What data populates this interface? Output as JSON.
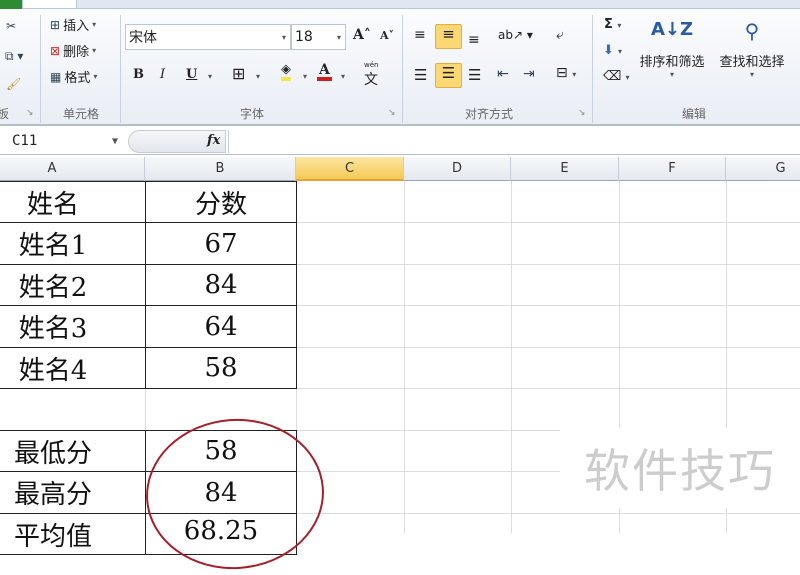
{
  "ribbon": {
    "cells_group": {
      "label": "单元格",
      "insert": "插入",
      "delete": "删除",
      "format": "格式"
    },
    "font_group": {
      "label": "字体",
      "font_name": "宋体",
      "font_size": "18",
      "bold": "B",
      "italic": "I",
      "underline": "U",
      "font_color_label": "A",
      "wen": "wén"
    },
    "alignment_group": {
      "label": "对齐方式"
    },
    "editing_group": {
      "label": "编辑",
      "sort_filter": "排序和筛选",
      "find_select": "查找和选择",
      "sum": "Σ"
    },
    "clipboard_group": {
      "label_fragment": "板"
    },
    "colors": {
      "highlight": "#f2e64b",
      "font_color": "#d01d1d",
      "active": "#fbd874"
    }
  },
  "formula_bar": {
    "name_box": "C11",
    "fx": "fx",
    "value": ""
  },
  "columns": [
    "A",
    "B",
    "C",
    "D",
    "E",
    "F",
    "G"
  ],
  "selected_column": "C",
  "table": {
    "header": [
      "姓名",
      "分数"
    ],
    "rows": [
      [
        "姓名1",
        "67"
      ],
      [
        "姓名2",
        "84"
      ],
      [
        "姓名3",
        "64"
      ],
      [
        "姓名4",
        "58"
      ]
    ]
  },
  "summary": [
    [
      "最低分",
      "58"
    ],
    [
      "最高分",
      "84"
    ],
    [
      "平均值",
      "68.25"
    ]
  ],
  "watermark": "软件技巧"
}
